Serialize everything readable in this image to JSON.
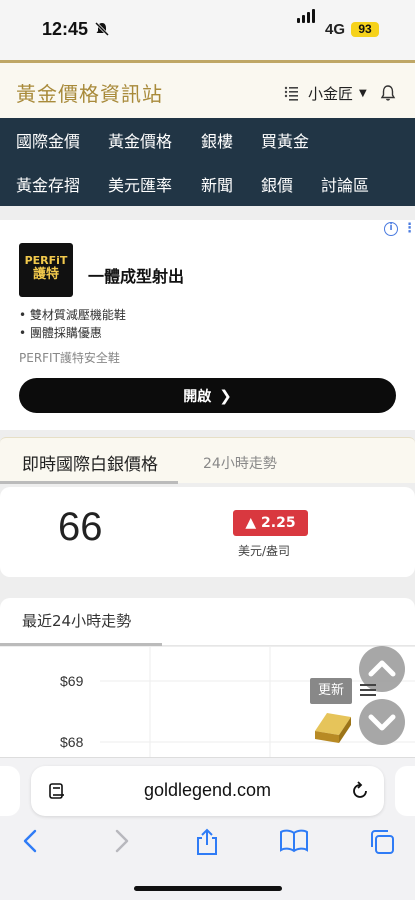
{
  "status_bar": {
    "time": "12:45",
    "network": "4G",
    "battery": "93"
  },
  "header": {
    "site_title": "黃金價格資訊站",
    "user_name": "小金匠"
  },
  "nav": {
    "row1": [
      "國際金價",
      "黃金價格",
      "銀樓",
      "買黃金"
    ],
    "row2": [
      "黃金存摺",
      "美元匯率",
      "新聞",
      "銀價",
      "討論區"
    ]
  },
  "ad": {
    "logo_line1": "PERFiT",
    "logo_line2": "護特",
    "title": "一體成型射出",
    "bullets": [
      "• 雙材質減壓機能鞋",
      "• 團體採購優惠"
    ],
    "brand": "PERFIT護特安全鞋",
    "cta": "開啟"
  },
  "silver": {
    "tab_active": "即時國際白銀價格",
    "tab_other": "24小時走勢",
    "price": "66",
    "change": "▲ 2.25",
    "unit": "美元/盎司"
  },
  "trend": {
    "title": "最近24小時走勢",
    "update_label": "更新"
  },
  "chart_data": {
    "type": "line",
    "title": "",
    "y_ticks": [
      "$69",
      "$68"
    ],
    "ylabel": "",
    "xlabel": "",
    "series": []
  },
  "browser": {
    "url": "goldlegend.com"
  }
}
